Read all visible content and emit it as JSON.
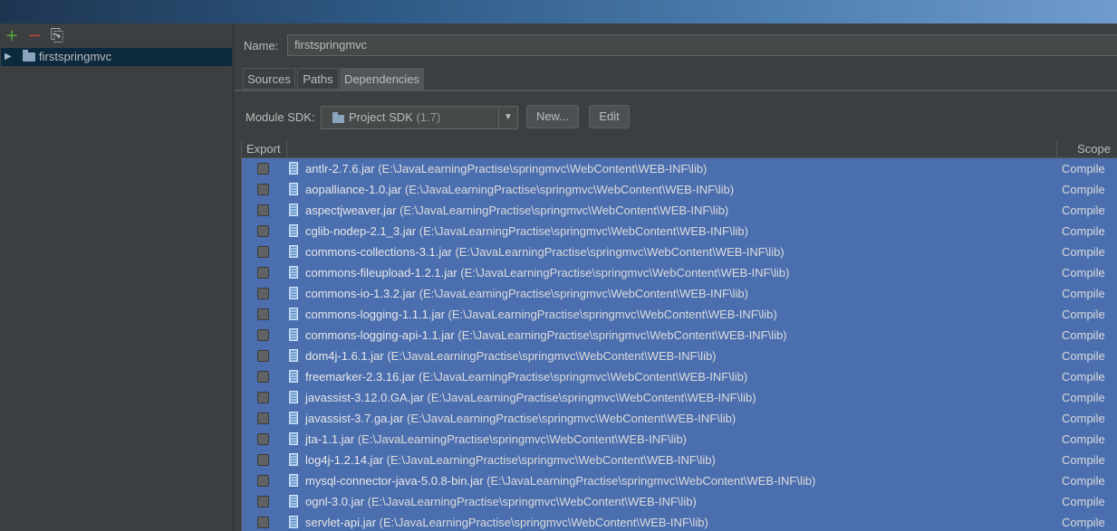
{
  "left_panel": {
    "toolbar": {
      "add_icon": "+",
      "remove_icon": "−",
      "copy_icon": "⎘"
    },
    "tree": {
      "module": "firstspringmvc",
      "expand_icon": "▶"
    }
  },
  "module": {
    "name_label": "Name:",
    "name_value": "firstspringmvc",
    "tabs": [
      "Sources",
      "Paths",
      "Dependencies"
    ],
    "active_tab": "Dependencies"
  },
  "sdk": {
    "label": "Module SDK:",
    "selected": "Project SDK",
    "version": "(1.7)",
    "dropdown_icon": "▼",
    "new_label": "New...",
    "edit_label": "Edit"
  },
  "table": {
    "headers": {
      "export": "Export",
      "scope": "Scope"
    },
    "rows": [
      {
        "name": "antlr-2.7.6.jar",
        "path": "(E:\\JavaLearningPractise\\springmvc\\WebContent\\WEB-INF\\lib)",
        "scope": "Compile"
      },
      {
        "name": "aopalliance-1.0.jar",
        "path": "(E:\\JavaLearningPractise\\springmvc\\WebContent\\WEB-INF\\lib)",
        "scope": "Compile"
      },
      {
        "name": "aspectjweaver.jar",
        "path": "(E:\\JavaLearningPractise\\springmvc\\WebContent\\WEB-INF\\lib)",
        "scope": "Compile"
      },
      {
        "name": "cglib-nodep-2.1_3.jar",
        "path": "(E:\\JavaLearningPractise\\springmvc\\WebContent\\WEB-INF\\lib)",
        "scope": "Compile"
      },
      {
        "name": "commons-collections-3.1.jar",
        "path": "(E:\\JavaLearningPractise\\springmvc\\WebContent\\WEB-INF\\lib)",
        "scope": "Compile"
      },
      {
        "name": "commons-fileupload-1.2.1.jar",
        "path": "(E:\\JavaLearningPractise\\springmvc\\WebContent\\WEB-INF\\lib)",
        "scope": "Compile"
      },
      {
        "name": "commons-io-1.3.2.jar",
        "path": "(E:\\JavaLearningPractise\\springmvc\\WebContent\\WEB-INF\\lib)",
        "scope": "Compile"
      },
      {
        "name": "commons-logging-1.1.1.jar",
        "path": "(E:\\JavaLearningPractise\\springmvc\\WebContent\\WEB-INF\\lib)",
        "scope": "Compile"
      },
      {
        "name": "commons-logging-api-1.1.jar",
        "path": "(E:\\JavaLearningPractise\\springmvc\\WebContent\\WEB-INF\\lib)",
        "scope": "Compile"
      },
      {
        "name": "dom4j-1.6.1.jar",
        "path": "(E:\\JavaLearningPractise\\springmvc\\WebContent\\WEB-INF\\lib)",
        "scope": "Compile"
      },
      {
        "name": "freemarker-2.3.16.jar",
        "path": "(E:\\JavaLearningPractise\\springmvc\\WebContent\\WEB-INF\\lib)",
        "scope": "Compile"
      },
      {
        "name": "javassist-3.12.0.GA.jar",
        "path": "(E:\\JavaLearningPractise\\springmvc\\WebContent\\WEB-INF\\lib)",
        "scope": "Compile"
      },
      {
        "name": "javassist-3.7.ga.jar",
        "path": "(E:\\JavaLearningPractise\\springmvc\\WebContent\\WEB-INF\\lib)",
        "scope": "Compile"
      },
      {
        "name": "jta-1.1.jar",
        "path": "(E:\\JavaLearningPractise\\springmvc\\WebContent\\WEB-INF\\lib)",
        "scope": "Compile"
      },
      {
        "name": "log4j-1.2.14.jar",
        "path": "(E:\\JavaLearningPractise\\springmvc\\WebContent\\WEB-INF\\lib)",
        "scope": "Compile"
      },
      {
        "name": "mysql-connector-java-5.0.8-bin.jar",
        "path": "(E:\\JavaLearningPractise\\springmvc\\WebContent\\WEB-INF\\lib)",
        "scope": "Compile"
      },
      {
        "name": "ognl-3.0.jar",
        "path": "(E:\\JavaLearningPractise\\springmvc\\WebContent\\WEB-INF\\lib)",
        "scope": "Compile"
      },
      {
        "name": "servlet-api.jar",
        "path": "(E:\\JavaLearningPractise\\springmvc\\WebContent\\WEB-INF\\lib)",
        "scope": "Compile"
      }
    ]
  },
  "colors": {
    "selection": "#4b6eaf",
    "panel": "#3c3f41",
    "tree_selection": "#0d293e"
  }
}
